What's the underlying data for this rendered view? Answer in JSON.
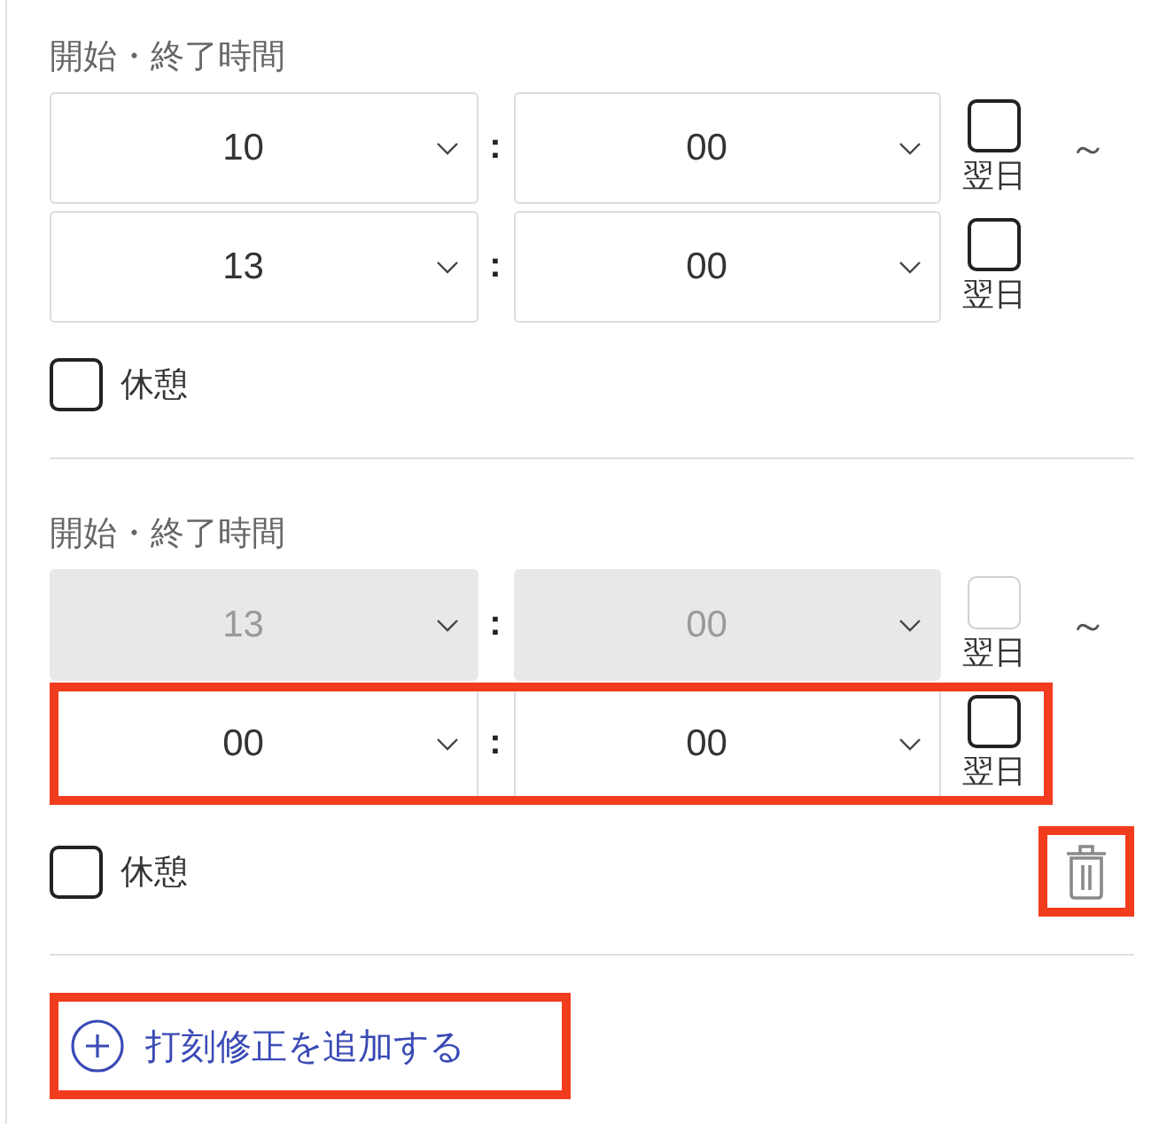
{
  "groups": [
    {
      "label": "開始・終了時間",
      "rows": [
        {
          "hour": "10",
          "separator": ":",
          "minute": "00",
          "next_day": {
            "label": "翌日",
            "checked": false
          },
          "range_mark": "～",
          "disabled": false,
          "highlighted": false
        },
        {
          "hour": "13",
          "separator": ":",
          "minute": "00",
          "next_day": {
            "label": "翌日",
            "checked": false
          },
          "disabled": false,
          "highlighted": false
        }
      ],
      "break": {
        "label": "休憩",
        "checked": false
      }
    },
    {
      "label": "開始・終了時間",
      "rows": [
        {
          "hour": "13",
          "separator": ":",
          "minute": "00",
          "next_day": {
            "label": "翌日",
            "checked": false
          },
          "range_mark": "～",
          "disabled": true,
          "highlighted": false
        },
        {
          "hour": "00",
          "separator": ":",
          "minute": "00",
          "next_day": {
            "label": "翌日",
            "checked": false
          },
          "disabled": false,
          "highlighted": true
        }
      ],
      "break": {
        "label": "休憩",
        "checked": false
      },
      "delete_button": {
        "highlighted": true
      }
    }
  ],
  "add_button": {
    "label": "打刻修正を追加する",
    "highlighted": true
  }
}
